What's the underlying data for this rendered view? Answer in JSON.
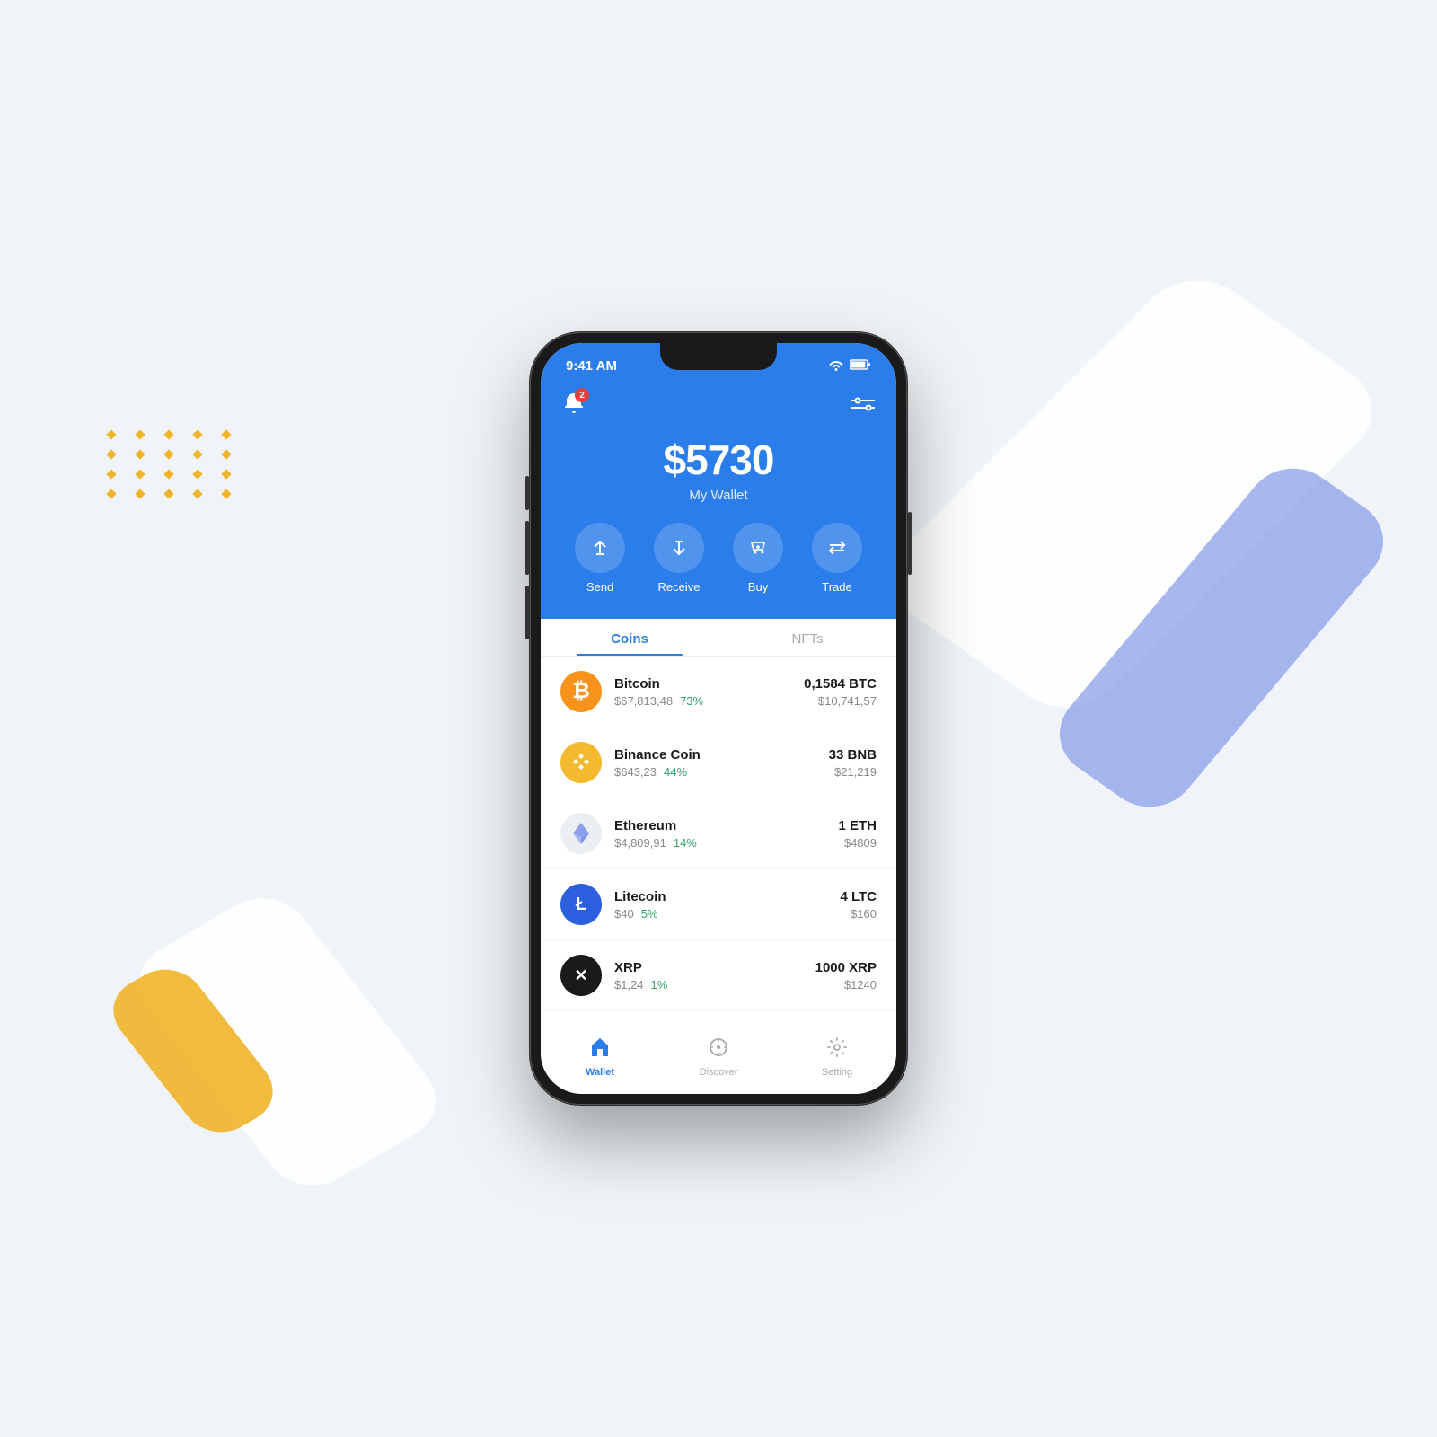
{
  "status_bar": {
    "time": "9:41 AM",
    "wifi": "📶",
    "battery": "🔋"
  },
  "header": {
    "notification_count": "2",
    "balance": "$5730",
    "wallet_label": "My Wallet"
  },
  "actions": [
    {
      "id": "send",
      "label": "Send",
      "icon": "↑"
    },
    {
      "id": "receive",
      "label": "Receive",
      "icon": "↓"
    },
    {
      "id": "buy",
      "label": "Buy",
      "icon": "🏷"
    },
    {
      "id": "trade",
      "label": "Trade",
      "icon": "⇄"
    }
  ],
  "tabs": [
    {
      "id": "coins",
      "label": "Coins",
      "active": true
    },
    {
      "id": "nfts",
      "label": "NFTs",
      "active": false
    }
  ],
  "coins": [
    {
      "name": "Bitcoin",
      "price": "$67,813,48",
      "change": "73%",
      "qty": "0,1584 BTC",
      "value": "$10,741,57",
      "logo_text": "₿",
      "logo_class": "btc-logo"
    },
    {
      "name": "Binance Coin",
      "price": "$643,23",
      "change": "44%",
      "qty": "33 BNB",
      "value": "$21,219",
      "logo_text": "◆",
      "logo_class": "bnb-logo"
    },
    {
      "name": "Ethereum",
      "price": "$4,809,91",
      "change": "14%",
      "qty": "1 ETH",
      "value": "$4809",
      "logo_text": "◆",
      "logo_class": "eth-logo"
    },
    {
      "name": "Litecoin",
      "price": "$40",
      "change": "5%",
      "qty": "4 LTC",
      "value": "$160",
      "logo_text": "Ł",
      "logo_class": "ltc-logo"
    },
    {
      "name": "XRP",
      "price": "$1,24",
      "change": "1%",
      "qty": "1000 XRP",
      "value": "$1240",
      "logo_text": "✕",
      "logo_class": "xrp-logo"
    }
  ],
  "bottom_nav": [
    {
      "id": "wallet",
      "label": "Wallet",
      "active": true,
      "icon": "🛡"
    },
    {
      "id": "discover",
      "label": "Discover",
      "active": false,
      "icon": "🧭"
    },
    {
      "id": "setting",
      "label": "Setting",
      "active": false,
      "icon": "⚙"
    }
  ],
  "dots": [
    1,
    2,
    3,
    4,
    5,
    6,
    7,
    8,
    9,
    10,
    11,
    12,
    13,
    14,
    15,
    16,
    17,
    18,
    19,
    20
  ]
}
